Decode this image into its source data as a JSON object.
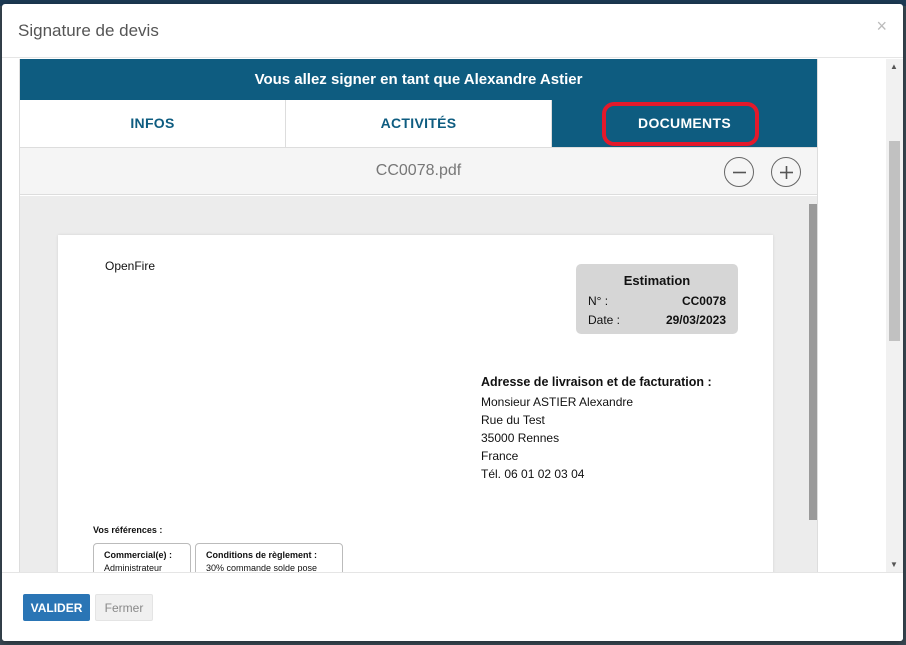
{
  "modal": {
    "title": "Signature de devis",
    "close": "×"
  },
  "banner": {
    "text": "Vous allez signer en tant que Alexandre Astier"
  },
  "tabs": [
    {
      "label": "INFOS",
      "active": false
    },
    {
      "label": "ACTIVITÉS",
      "active": false
    },
    {
      "label": "DOCUMENTS",
      "active": true
    }
  ],
  "viewer": {
    "filename": "CC0078.pdf"
  },
  "document": {
    "company": "OpenFire",
    "estimate": {
      "title": "Estimation",
      "number_label": "N° :",
      "number": "CC0078",
      "date_label": "Date :",
      "date": "29/03/2023"
    },
    "address": {
      "heading": "Adresse de livraison et de facturation :",
      "lines": [
        "Monsieur ASTIER Alexandre",
        "Rue du Test",
        "35000 Rennes",
        "France",
        "Tél. 06 01 02 03 04"
      ]
    },
    "references": {
      "label": "Vos références :",
      "boxes": [
        {
          "heading": "Commercial(e) :",
          "value": "Administrateur"
        },
        {
          "heading": "Conditions de règlement :",
          "value": "30% commande solde pose"
        }
      ]
    }
  },
  "footer": {
    "validate_label": "VALIDER",
    "close_label": "Fermer"
  },
  "colors": {
    "brand": "#0e5c80",
    "highlight": "#e3192b",
    "validate": "#2a75b5"
  }
}
